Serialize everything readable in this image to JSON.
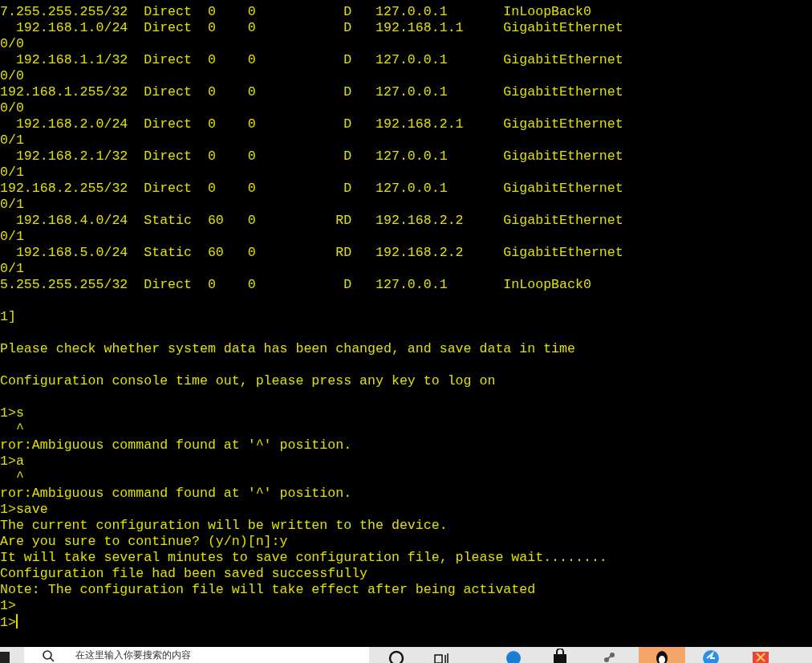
{
  "terminal": {
    "blocks": [
      [
        "7.255.255.255/32  Direct  0    0           D   127.0.0.1       InLoopBack0",
        "  192.168.1.0/24  Direct  0    0           D   192.168.1.1     GigabitEthernet",
        "0/0",
        "  192.168.1.1/32  Direct  0    0           D   127.0.0.1       GigabitEthernet",
        "0/0",
        "192.168.1.255/32  Direct  0    0           D   127.0.0.1       GigabitEthernet",
        "0/0",
        "  192.168.2.0/24  Direct  0    0           D   192.168.2.1     GigabitEthernet",
        "0/1",
        "  192.168.2.1/32  Direct  0    0           D   127.0.0.1       GigabitEthernet",
        "0/1",
        "192.168.2.255/32  Direct  0    0           D   127.0.0.1       GigabitEthernet",
        "0/1",
        "  192.168.4.0/24  Static  60   0          RD   192.168.2.2     GigabitEthernet",
        "0/1",
        "  192.168.5.0/24  Static  60   0          RD   192.168.2.2     GigabitEthernet",
        "0/1",
        "5.255.255.255/32  Direct  0    0           D   127.0.0.1       InLoopBack0"
      ],
      [
        "1]"
      ],
      [
        "Please check whether system data has been changed, and save data in time"
      ],
      [
        "Configuration console time out, please press any key to log on"
      ],
      [
        "1>s",
        "  ^",
        "ror:Ambiguous command found at '^' position.",
        "1>a",
        "  ^",
        "ror:Ambiguous command found at '^' position.",
        "1>save",
        "The current configuration will be written to the device.",
        "Are you sure to continue? (y/n)[n]:y",
        "It will take several minutes to save configuration file, please wait........",
        "Configuration file had been saved successfully",
        "Note: The configuration file will take effect after being activated",
        "1>",
        "1>"
      ]
    ],
    "cursor_visible": true
  },
  "taskbar": {
    "search": {
      "placeholder": "在这里输入你要搜索的内容"
    }
  }
}
